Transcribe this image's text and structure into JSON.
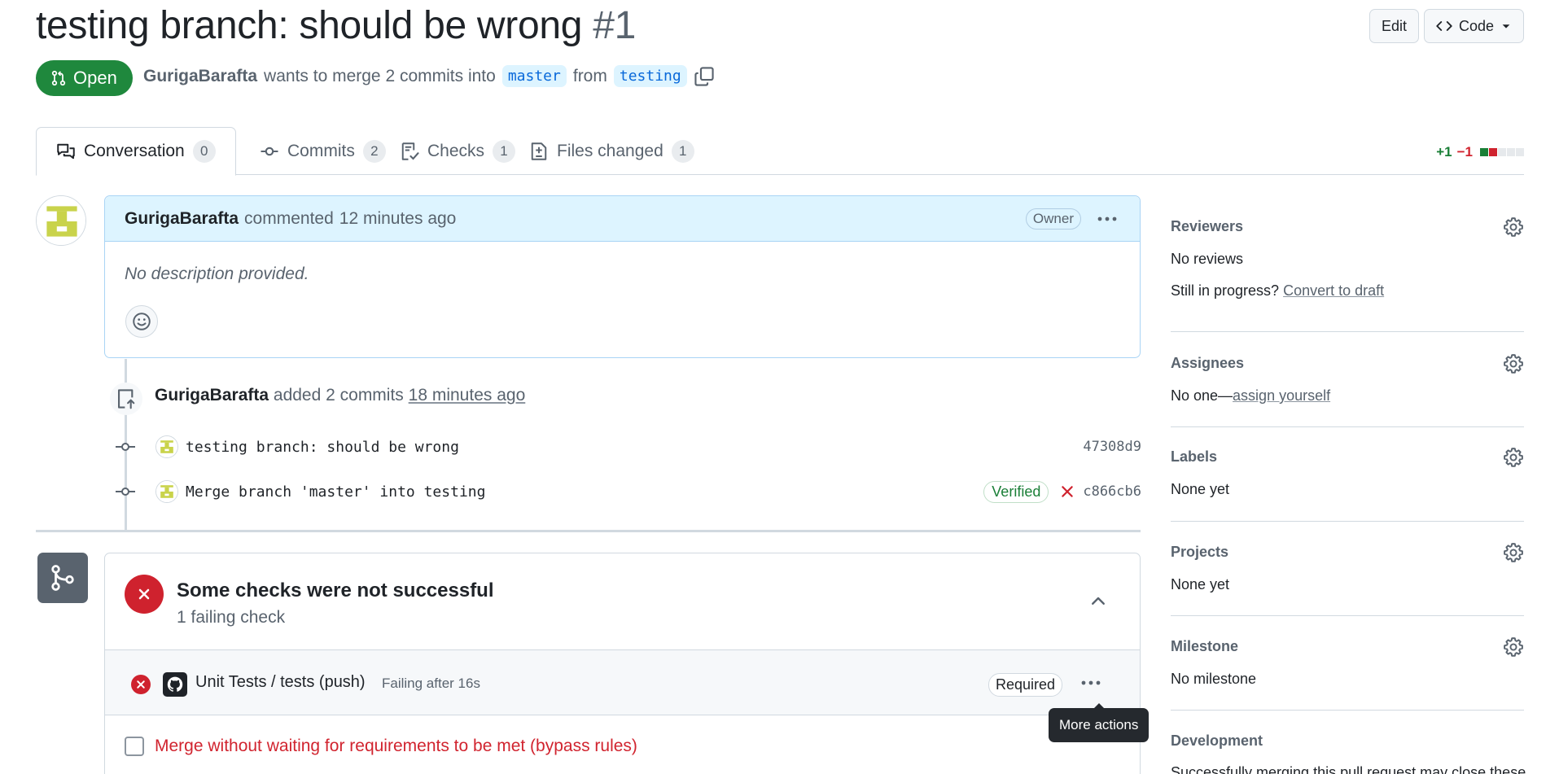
{
  "pr": {
    "title": "testing branch: should be wrong",
    "number": "#1",
    "state": "Open",
    "author": "GurigaBarafta",
    "merge_text": "wants to merge 2 commits into",
    "base_branch": "master",
    "from_text": "from",
    "head_branch": "testing"
  },
  "header_buttons": {
    "edit": "Edit",
    "code": "Code"
  },
  "tabs": [
    {
      "label": "Conversation",
      "count": "0"
    },
    {
      "label": "Commits",
      "count": "2"
    },
    {
      "label": "Checks",
      "count": "1"
    },
    {
      "label": "Files changed",
      "count": "1"
    }
  ],
  "diffstat": {
    "additions": "+1",
    "deletions": "−1",
    "colors": [
      "#1a7f37",
      "#cf222e",
      "#e6e9ec",
      "#e6e9ec",
      "#e6e9ec"
    ]
  },
  "comment": {
    "author": "GurigaBarafta",
    "action": "commented",
    "time": "12 minutes ago",
    "role": "Owner",
    "body": "No description provided."
  },
  "push_event": {
    "author": "GurigaBarafta",
    "action": "added 2 commits",
    "time": "18 minutes ago"
  },
  "commits": [
    {
      "message": "testing branch: should be wrong",
      "sha": "47308d9",
      "verified": "",
      "status": ""
    },
    {
      "message": "Merge branch 'master' into testing",
      "sha": "c866cb6",
      "verified": "Verified",
      "status": "failed"
    }
  ],
  "checks": {
    "title": "Some checks were not successful",
    "subtitle": "1 failing check",
    "items": [
      {
        "name": "Unit Tests / tests (push)",
        "detail": "Failing after 16s",
        "badge": "Required"
      }
    ],
    "bypass_label": "Merge without waiting for requirements to be met (bypass rules)",
    "tooltip": "More actions"
  },
  "sidebar": {
    "reviewers": {
      "title": "Reviewers",
      "value": "No reviews",
      "hint": "Still in progress?",
      "link": "Convert to draft"
    },
    "assignees": {
      "title": "Assignees",
      "value": "No one—",
      "link": "assign yourself"
    },
    "labels": {
      "title": "Labels",
      "value": "None yet"
    },
    "projects": {
      "title": "Projects",
      "value": "None yet"
    },
    "milestone": {
      "title": "Milestone",
      "value": "No milestone"
    },
    "development": {
      "title": "Development",
      "value": "Successfully merging this pull request may close these"
    }
  },
  "colors": {
    "open": "#1f883d",
    "failed": "#cf222e",
    "link": "#0969da"
  }
}
